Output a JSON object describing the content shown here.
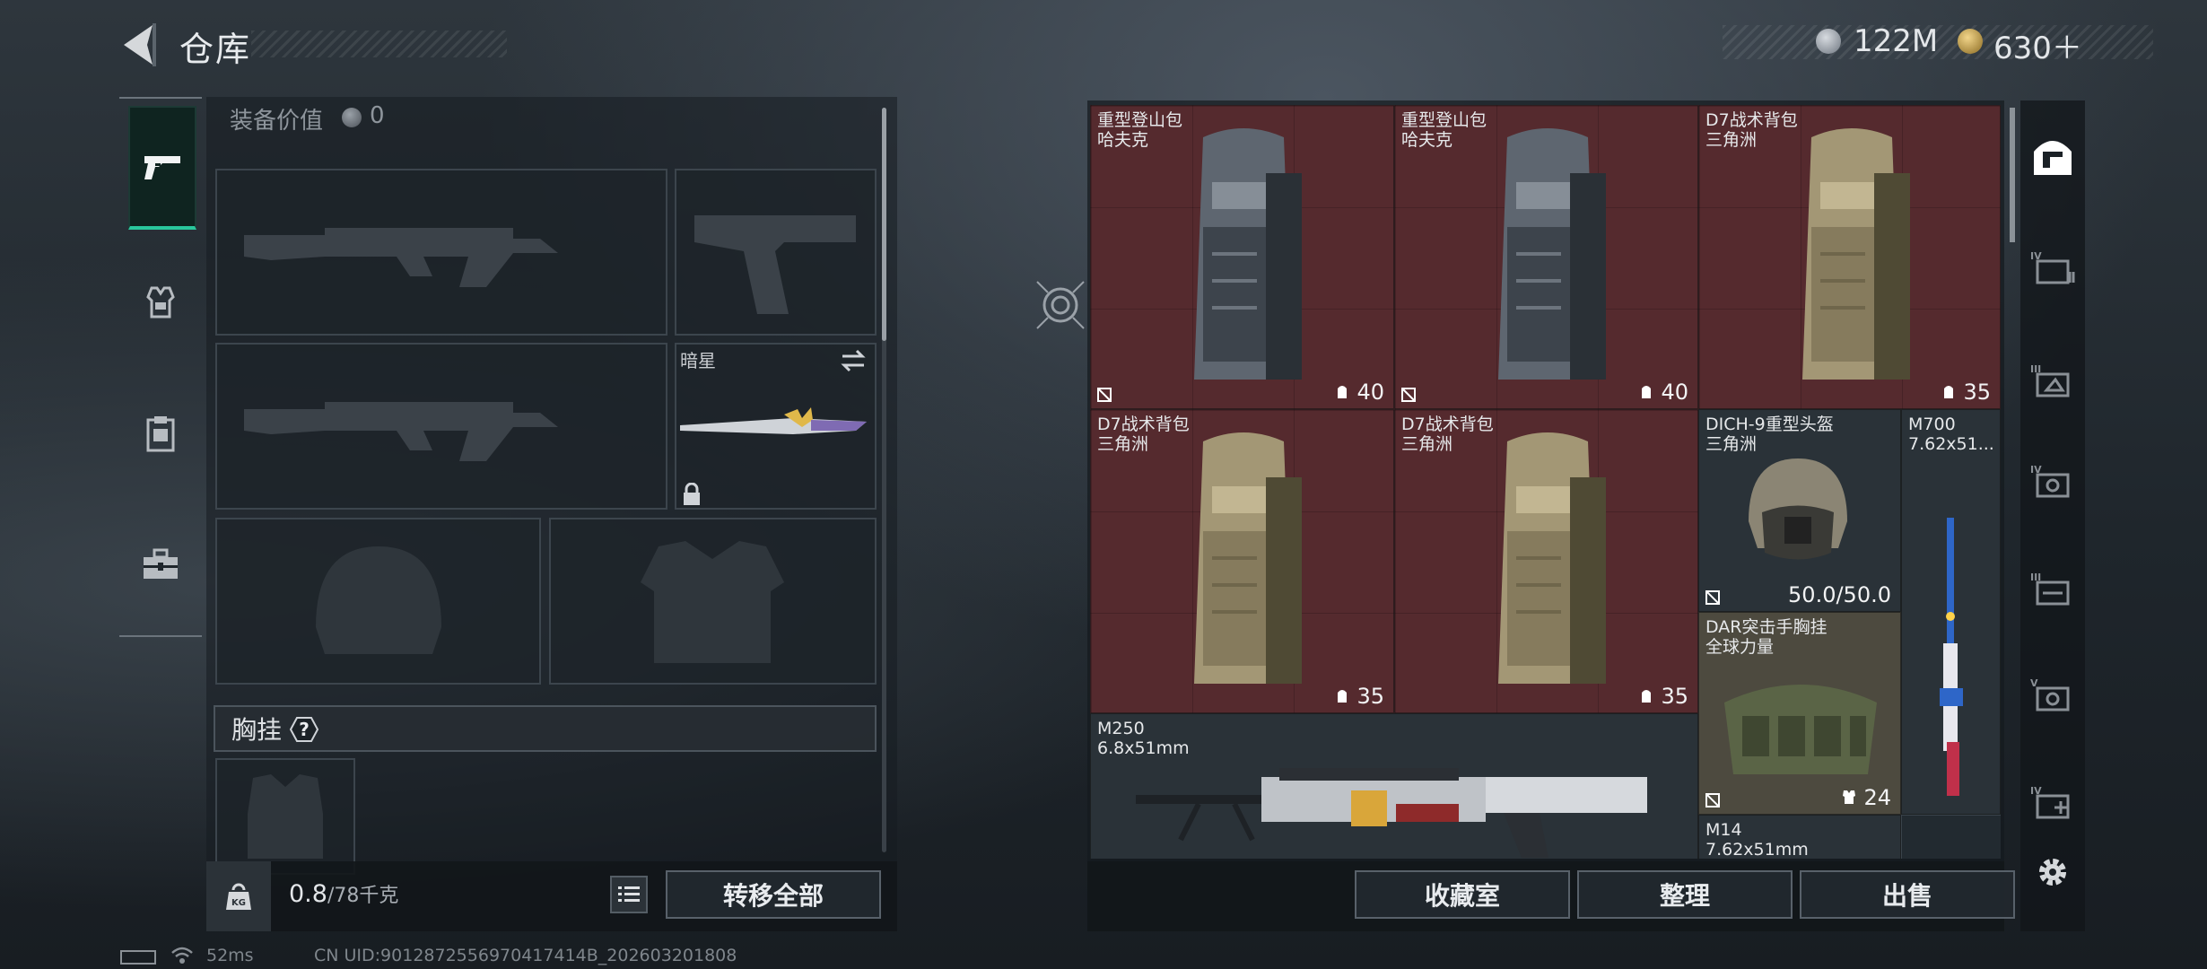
{
  "header": {
    "title": "仓库"
  },
  "currency": [
    {
      "icon": "silver-coin-icon",
      "value": "122M"
    },
    {
      "icon": "gold-coin-icon",
      "value": "630＋"
    }
  ],
  "side_tabs": [
    {
      "name": "weapons",
      "icon": "pistol-icon",
      "active": true
    },
    {
      "name": "armor",
      "icon": "armor-vest-icon",
      "active": false
    },
    {
      "name": "rig",
      "icon": "clipboard-icon",
      "active": false
    },
    {
      "name": "cases",
      "icon": "toolbox-icon",
      "active": false
    }
  ],
  "equipment": {
    "value_label": "装备价值",
    "value": "0",
    "melee_name": "暗星",
    "rig_label": "胸挂",
    "rig_help": "?"
  },
  "weight": {
    "current": "0.8",
    "max": "/78千克"
  },
  "buttons": {
    "transfer_all": "转移全部",
    "collection": "收藏室",
    "sort": "整理",
    "sell": "出售"
  },
  "stash_items": [
    {
      "name": "重型登山包",
      "sub": "哈夫克",
      "capacity": "40",
      "type": "backpack-gray"
    },
    {
      "name": "重型登山包",
      "sub": "哈夫克",
      "capacity": "40",
      "type": "backpack-gray"
    },
    {
      "name": "D7战术背包",
      "sub": "三角洲",
      "capacity": "35",
      "type": "backpack-tan"
    },
    {
      "name": "D7战术背包",
      "sub": "三角洲",
      "capacity": "35",
      "type": "backpack-tan"
    },
    {
      "name": "D7战术背包",
      "sub": "三角洲",
      "capacity": "35",
      "type": "backpack-tan"
    },
    {
      "name": "DICH-9重型头盔",
      "sub": "三角洲",
      "capacity": "50.0/50.0",
      "type": "helmet"
    },
    {
      "name": "M700",
      "sub": "7.62x51...",
      "capacity": "",
      "type": "sniper-rifle"
    },
    {
      "name": "DAR突击手胸挂",
      "sub": "全球力量",
      "capacity": "24",
      "type": "chest-rig"
    },
    {
      "name": "M250",
      "sub": "6.8x51mm",
      "capacity": "",
      "type": "machine-gun"
    },
    {
      "name": "M14",
      "sub": "7.62x51mm",
      "capacity": "",
      "type": "rifle"
    }
  ],
  "right_tabs": [
    "home-icon",
    "tier-iv-icon",
    "tier-iii-icon",
    "tier-iv-icon-2",
    "tier-iii-icon-2",
    "tier-v-icon",
    "tier-iv-add-icon"
  ],
  "footer": {
    "ping": "52ms",
    "uid": "CN UID:9012872556970417414B_202603201808"
  }
}
